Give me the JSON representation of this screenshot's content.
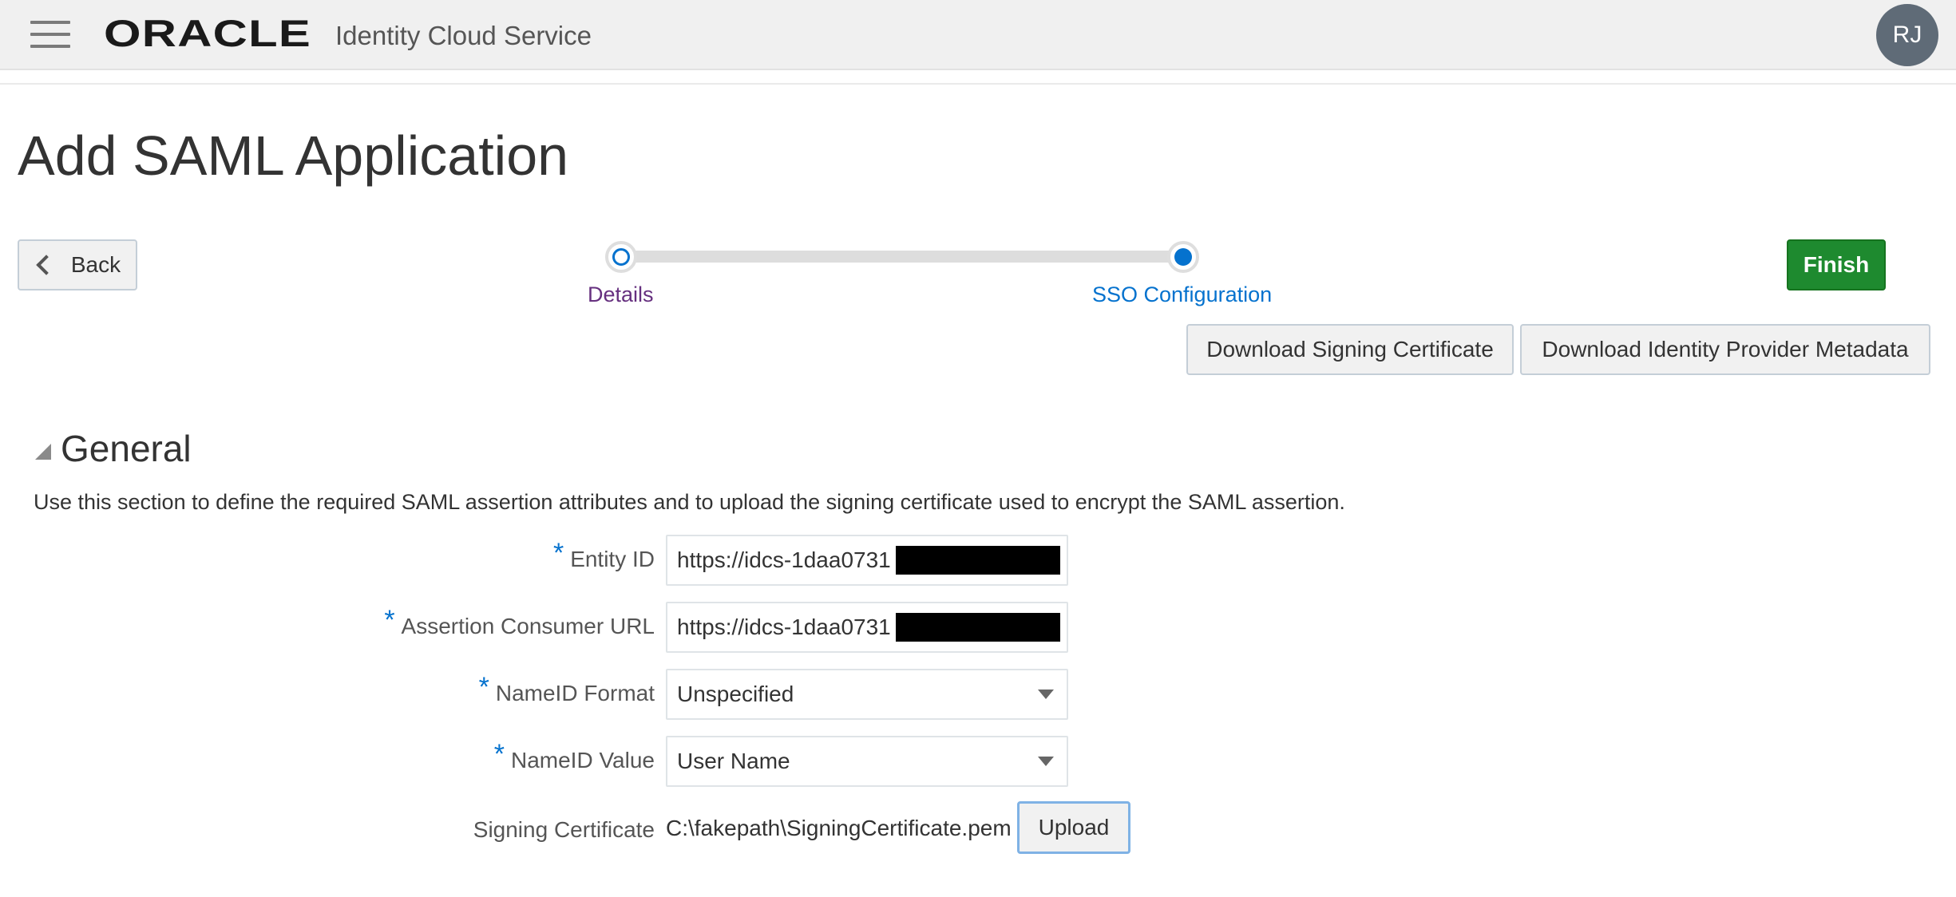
{
  "header": {
    "logo_text": "ORACLE",
    "product_name": "Identity Cloud Service",
    "avatar_initials": "RJ"
  },
  "page": {
    "title": "Add SAML Application"
  },
  "actions": {
    "back_label": "Back",
    "finish_label": "Finish",
    "download_signing_cert_label": "Download Signing Certificate",
    "download_idp_metadata_label": "Download Identity Provider Metadata"
  },
  "train": {
    "steps": [
      {
        "label": "Details",
        "state": "visited"
      },
      {
        "label": "SSO Configuration",
        "state": "current"
      }
    ]
  },
  "general": {
    "title": "General",
    "description": "Use this section to define the required SAML assertion attributes and to upload the signing certificate used to encrypt the SAML assertion.",
    "fields": {
      "entity_id": {
        "label": "Entity ID",
        "required": true,
        "value": "https://idcs-1daa0731"
      },
      "acs_url": {
        "label": "Assertion Consumer URL",
        "required": true,
        "value": "https://idcs-1daa0731"
      },
      "nameid_format": {
        "label": "NameID Format",
        "required": true,
        "value": "Unspecified"
      },
      "nameid_value": {
        "label": "NameID Value",
        "required": true,
        "value": "User Name"
      },
      "signing_certificate": {
        "label": "Signing Certificate",
        "required": false,
        "value": "C:\\fakepath\\SigningCertificate.pem",
        "upload_label": "Upload"
      }
    },
    "required_marker": "*"
  },
  "colors": {
    "accent": "#0572ce",
    "finish_green": "#1e8a2f",
    "visited_step": "#66307f",
    "header_bg": "#f0f0f0"
  },
  "icons": {
    "menu": "hamburger-icon",
    "back": "chevron-left-icon",
    "section_toggle": "triangle-expanded-icon",
    "select_caret": "caret-down-icon"
  }
}
